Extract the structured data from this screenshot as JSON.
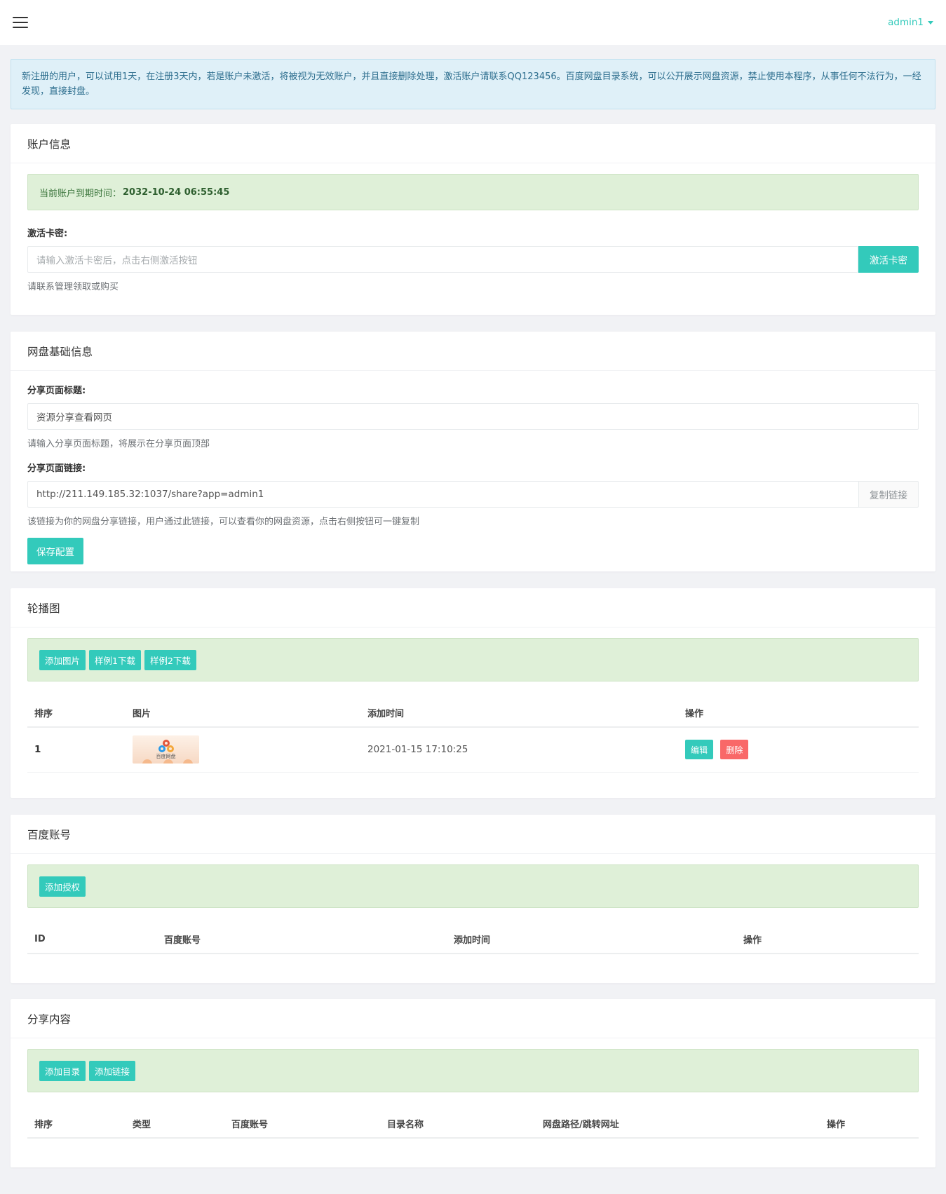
{
  "header": {
    "user": "admin1"
  },
  "notice": "新注册的用户，可以试用1天，在注册3天内，若是账户未激活，将被视为无效账户，并且直接删除处理，激活账户请联系QQ123456。百度网盘目录系统，可以公开展示网盘资源，禁止使用本程序，从事任何不法行为，一经发现，直接封盘。",
  "account": {
    "title": "账户信息",
    "expire_label": "当前账户到期时间：",
    "expire_value": "2032-10-24 06:55:45",
    "key_label": "激活卡密:",
    "key_placeholder": "请输入激活卡密后，点击右侧激活按钮",
    "activate_btn": "激活卡密",
    "help": "请联系管理领取或购买"
  },
  "basic": {
    "title": "网盘基础信息",
    "share_title_label": "分享页面标题:",
    "share_title_value": "资源分享查看网页",
    "share_title_help": "请输入分享页面标题，将展示在分享页面顶部",
    "share_link_label": "分享页面链接:",
    "share_link_value": "http://211.149.185.32:1037/share?app=admin1",
    "copy_btn": "复制链接",
    "share_link_help": "该链接为你的网盘分享链接，用户通过此链接，可以查看你的网盘资源，点击右侧按钮可一键复制",
    "save_btn": "保存配置"
  },
  "carousel": {
    "title": "轮播图",
    "buttons": [
      "添加图片",
      "样例1下载",
      "样例2下载"
    ],
    "columns": [
      "排序",
      "图片",
      "添加时间",
      "操作"
    ],
    "rows": [
      {
        "order": "1",
        "image_caption": "百度网盘",
        "time": "2021-01-15 17:10:25",
        "edit": "编辑",
        "delete": "删除"
      }
    ]
  },
  "baidu": {
    "title": "百度账号",
    "add_btn": "添加授权",
    "columns": [
      "ID",
      "百度账号",
      "添加时间",
      "操作"
    ]
  },
  "share": {
    "title": "分享内容",
    "buttons": [
      "添加目录",
      "添加链接"
    ],
    "columns": [
      "排序",
      "类型",
      "百度账号",
      "目录名称",
      "网盘路径/跳转网址",
      "操作"
    ]
  },
  "colors": {
    "accent": "#33cabb",
    "danger": "#f96868",
    "info_bg": "#dff0f8",
    "success_bg": "#dff0d8"
  }
}
